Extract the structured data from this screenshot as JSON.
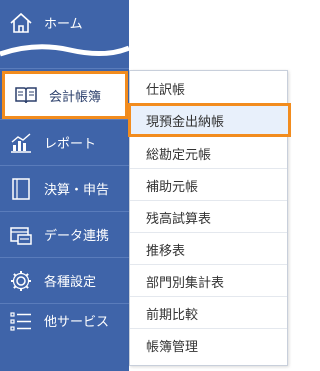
{
  "sidebar": {
    "items": [
      {
        "label": "ホーム",
        "icon": "home-icon"
      },
      {
        "label": "会計帳簿",
        "icon": "book-icon"
      },
      {
        "label": "レポート",
        "icon": "chart-icon"
      },
      {
        "label": "決算・申告",
        "icon": "document-icon"
      },
      {
        "label": "データ連携",
        "icon": "data-link-icon"
      },
      {
        "label": "各種設定",
        "icon": "gear-icon"
      },
      {
        "label": "他サービス",
        "icon": "list-icon"
      }
    ]
  },
  "submenu": {
    "items": [
      {
        "label": "仕訳帳"
      },
      {
        "label": "現預金出納帳"
      },
      {
        "label": "総勘定元帳"
      },
      {
        "label": "補助元帳"
      },
      {
        "label": "残高試算表"
      },
      {
        "label": "推移表"
      },
      {
        "label": "部門別集計表"
      },
      {
        "label": "前期比較"
      },
      {
        "label": "帳簿管理"
      }
    ]
  },
  "colors": {
    "sidebar": "#3f64a9",
    "highlight": "#f28c1e"
  }
}
